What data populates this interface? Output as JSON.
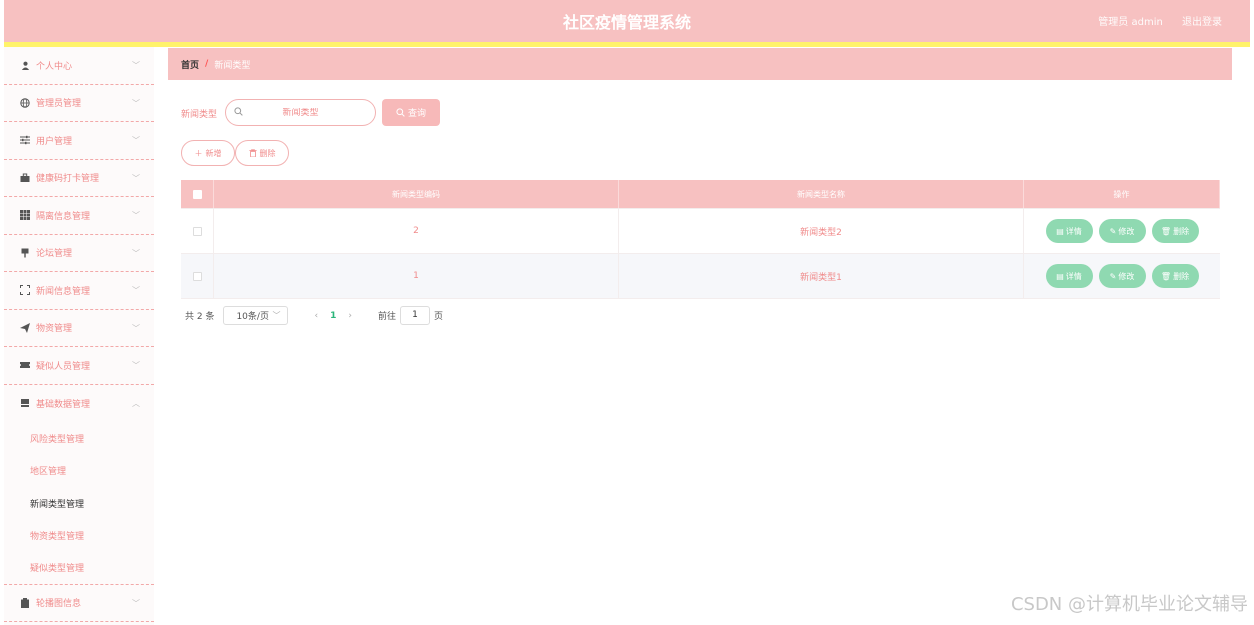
{
  "header": {
    "title": "社区疫情管理系统",
    "admin_label": "管理员 admin",
    "logout_label": "退出登录"
  },
  "sidebar": {
    "items": [
      {
        "label": "个人中心",
        "icon": "user-icon"
      },
      {
        "label": "管理员管理",
        "icon": "globe-icon"
      },
      {
        "label": "用户管理",
        "icon": "sliders-icon"
      },
      {
        "label": "健康码打卡管理",
        "icon": "briefcase-icon"
      },
      {
        "label": "隔离信息管理",
        "icon": "grid-icon"
      },
      {
        "label": "论坛管理",
        "icon": "pin-icon"
      },
      {
        "label": "新闻信息管理",
        "icon": "expand-icon"
      },
      {
        "label": "物资管理",
        "icon": "send-icon"
      },
      {
        "label": "疑似人员管理",
        "icon": "ticket-icon"
      },
      {
        "label": "基础数据管理",
        "icon": "stack-icon"
      }
    ],
    "sub_items": [
      "风险类型管理",
      "地区管理",
      "新闻类型管理",
      "物资类型管理",
      "疑似类型管理"
    ],
    "last_item": {
      "label": "轮播图信息",
      "icon": "clipboard-icon"
    }
  },
  "breadcrumb": {
    "home": "首页",
    "separator": "/",
    "current": "新闻类型"
  },
  "search": {
    "label": "新闻类型",
    "placeholder": "新闻类型",
    "query_label": "查询"
  },
  "actions": {
    "add_label": "新增",
    "delete_label": "删除"
  },
  "table": {
    "headers": [
      "新闻类型编码",
      "新闻类型名称",
      "操作"
    ],
    "rows": [
      {
        "code": "2",
        "name": "新闻类型2"
      },
      {
        "code": "1",
        "name": "新闻类型1"
      }
    ],
    "op_detail": "详情",
    "op_edit": "修改",
    "op_delete": "删除"
  },
  "pagination": {
    "total": "共 2 条",
    "page_size": "10条/页",
    "current_page": "1",
    "goto_label": "前往",
    "goto_value": "1",
    "page_unit": "页"
  },
  "watermark": "CSDN @计算机毕业论文辅导",
  "colors": {
    "header": "#f7c1c1",
    "accent_yellow": "#fff36a",
    "op_button": "#8fd9b1",
    "text_pink": "#f08b8b"
  }
}
